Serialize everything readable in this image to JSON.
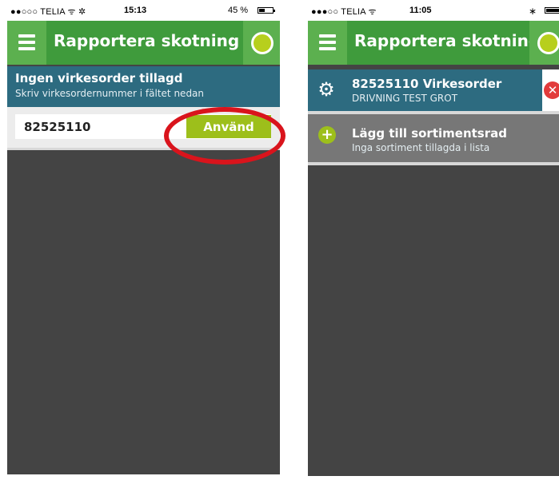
{
  "colors": {
    "appbar": "#3f9b3c",
    "appbar_button": "#5cb04f",
    "status_dot": "#b7cf1d",
    "info_row": "#2d6b80",
    "order_row": "#2d6b80",
    "add_row": "#777777",
    "body": "#444444",
    "accent_button": "#9dbf1b",
    "highlight": "#d9141c",
    "remove": "#e23b3b"
  },
  "left_phone": {
    "status_bar": {
      "carrier": "●●○○○ TELIA ᯤ ✲",
      "time": "15:13",
      "battery": "45 %",
      "battery_level": 0.45
    },
    "app_title": "Rapportera skotning",
    "menu_icon": "hamburger-menu-icon",
    "status_icon": "status-circle-icon",
    "info": {
      "title": "Ingen virkesorder tillagd",
      "subtitle": "Skriv virkesordernummer i fältet nedan"
    },
    "order_input_value": "82525110",
    "use_button_label": "Använd"
  },
  "right_phone": {
    "status_bar": {
      "carrier": "●●●○○ TELIA ᯤ",
      "time": "11:05"
    },
    "app_title": "Rapportera skotning",
    "order": {
      "title": "82525110 Virkesorder",
      "subtitle": "DRIVNING TEST GROT",
      "icon": "gear-icon",
      "remove_icon": "close-icon"
    },
    "add_row": {
      "title": "Lägg till sortimentsrad",
      "subtitle": "Inga sortiment tillagda i lista",
      "icon": "plus-icon"
    }
  }
}
